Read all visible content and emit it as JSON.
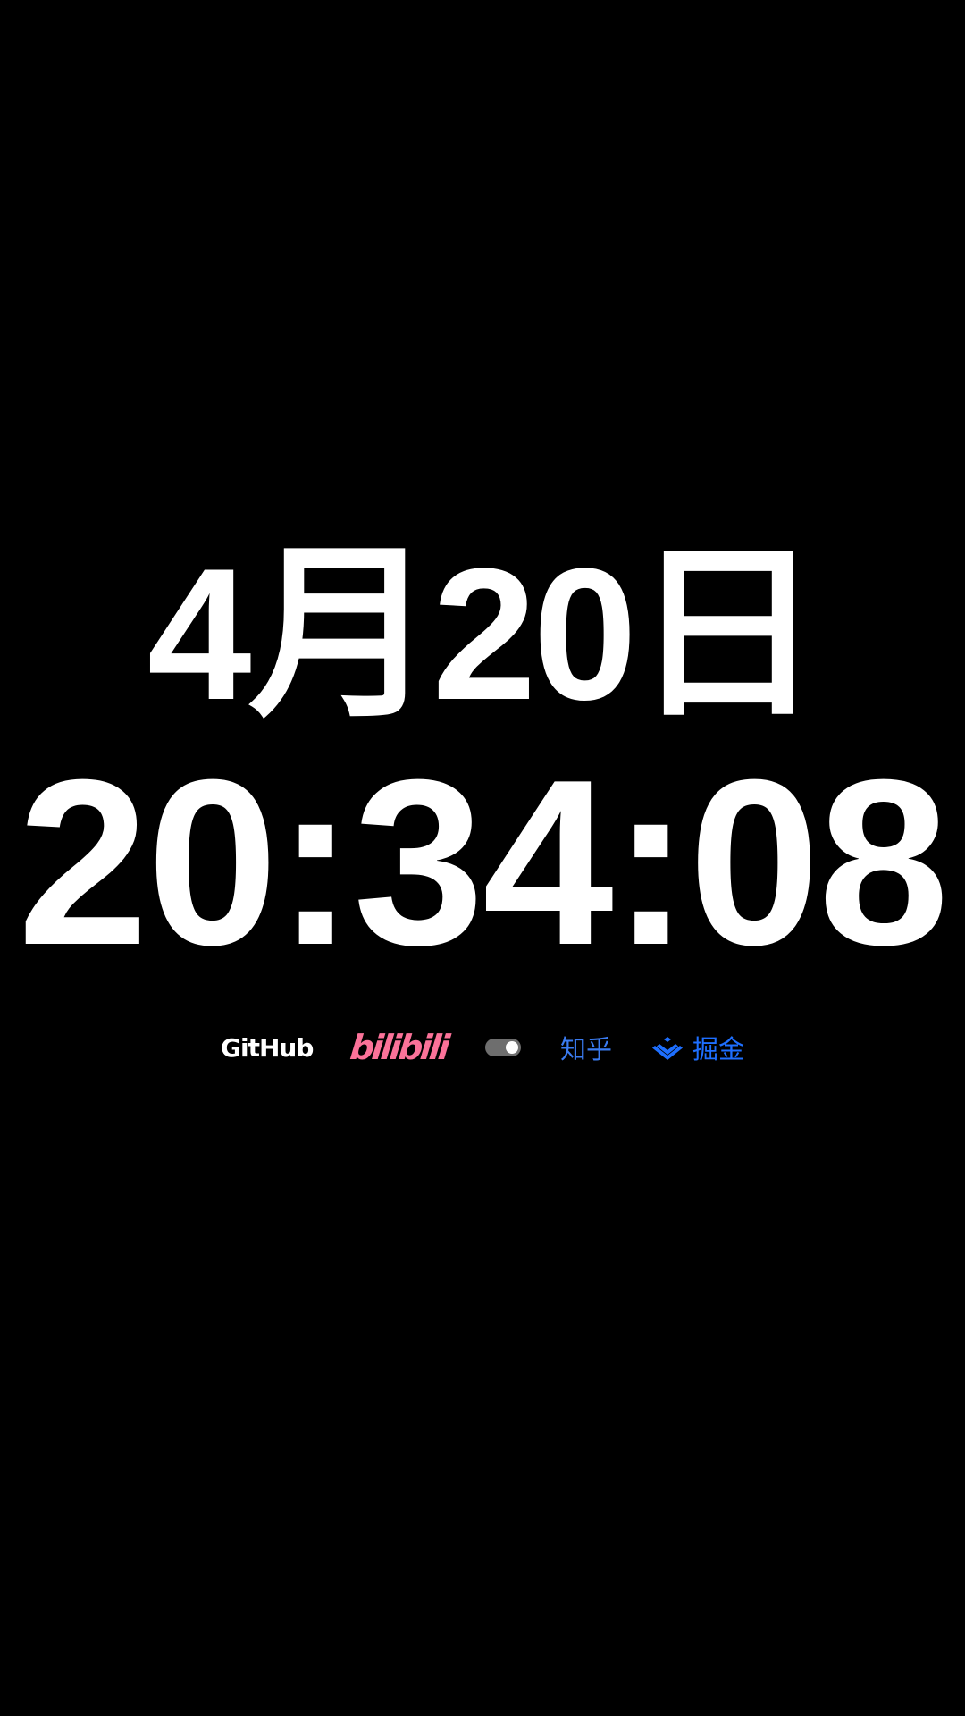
{
  "clock": {
    "date": "4月20日",
    "time": "20:34:08"
  },
  "links": {
    "github": {
      "label": "GitHub",
      "color": "#ffffff"
    },
    "bilibili": {
      "label": "bilibili",
      "color": "#fb7299"
    },
    "toggle": {
      "state": "on",
      "track_color": "#6e6e6e"
    },
    "zhihu": {
      "label": "知乎",
      "color": "#3a7bf0"
    },
    "juejin": {
      "label": "掘金",
      "icon": "juejin-icon",
      "color": "#1e6fff"
    }
  }
}
